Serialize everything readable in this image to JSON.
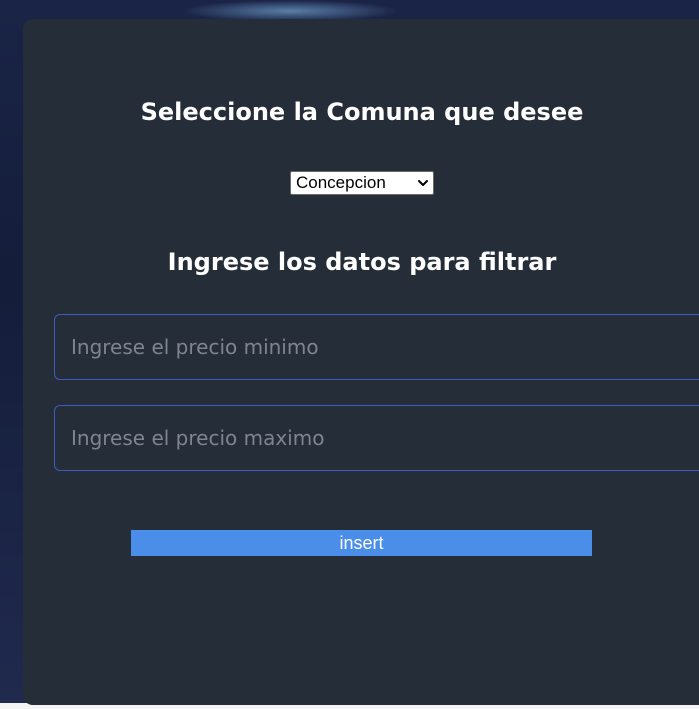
{
  "headings": {
    "comuna_title": "Seleccione la Comuna que desee",
    "filter_title": "Ingrese los datos para filtrar"
  },
  "comuna_select": {
    "selected": "Concepcion"
  },
  "filters": {
    "min_price_placeholder": "Ingrese el precio minimo",
    "min_price_value": "",
    "max_price_placeholder": "Ingrese el precio maximo",
    "max_price_value": ""
  },
  "actions": {
    "insert_label": "insert"
  },
  "colors": {
    "panel_bg": "#252d38",
    "accent": "#4a8eea",
    "input_border": "#3e5dbb"
  },
  "icons": {
    "select_arrow": "chevron-down-icon"
  }
}
